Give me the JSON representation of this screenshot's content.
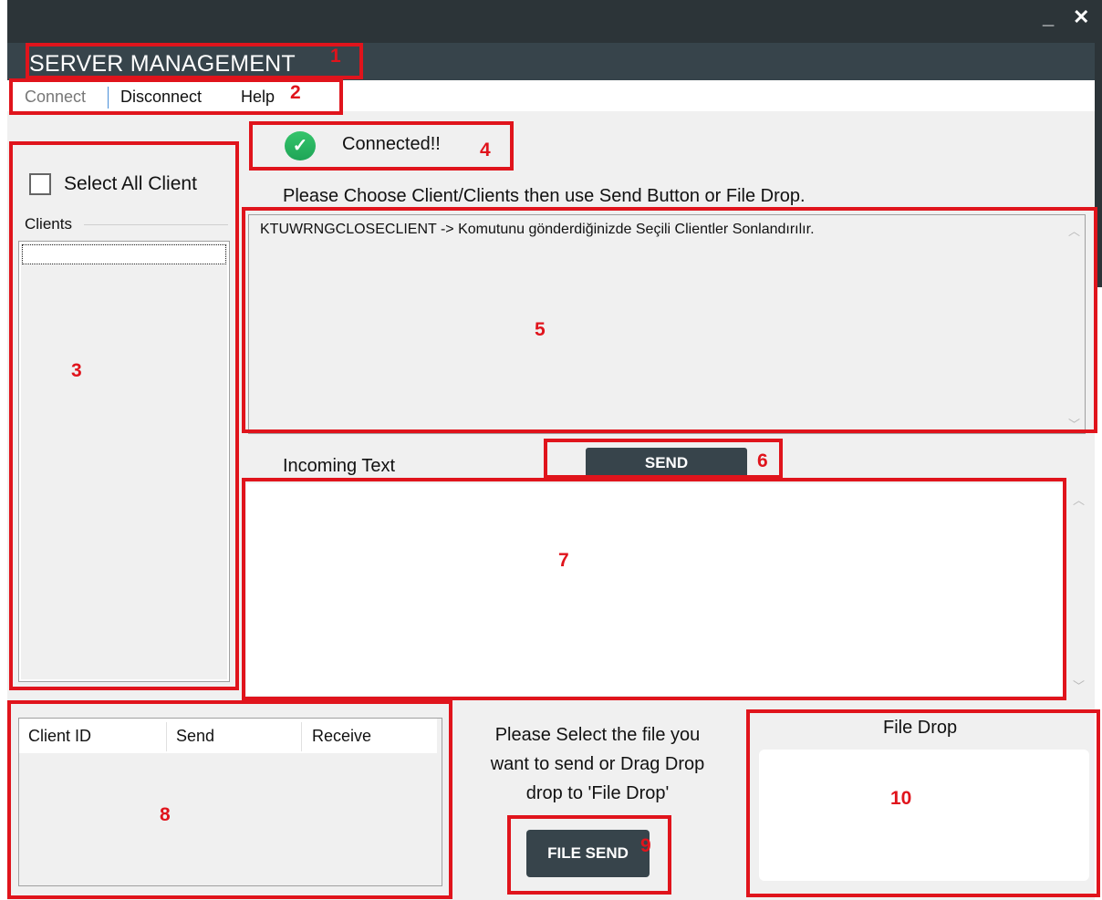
{
  "window": {
    "title": "SERVER MANAGEMENT",
    "minimize_glyph": "_",
    "close_glyph": "✕"
  },
  "menu": {
    "items": [
      {
        "label": "Connect"
      },
      {
        "label": "Disconnect"
      },
      {
        "label": "Help"
      }
    ]
  },
  "status": {
    "text": "Connected!!",
    "icon": "check-circle-icon",
    "color": "#1fa557"
  },
  "clients_panel": {
    "select_all_label": "Select All Client",
    "select_all_checked": false,
    "group_label": "Clients",
    "items": []
  },
  "send_area": {
    "instruction": "Please Choose Client/Clients then use Send Button or File Drop.",
    "text": "KTUWRNGCLOSECLIENT -> Komutunu gönderdiğinizde Seçili Clientler Sonlandırılır."
  },
  "send_button": {
    "label": "SEND"
  },
  "incoming": {
    "label": "Incoming Text",
    "text": ""
  },
  "transfer_table": {
    "columns": [
      "Client ID",
      "Send",
      "Receive"
    ],
    "rows": []
  },
  "file_section": {
    "instruction_lines": [
      "Please Select the file you",
      "want to send or Drag Drop",
      "drop to 'File Drop'"
    ],
    "file_send_label": "FILE SEND",
    "file_drop_label": "File Drop"
  },
  "annotations": [
    "1",
    "2",
    "3",
    "4",
    "5",
    "6",
    "7",
    "8",
    "9",
    "10"
  ],
  "colors": {
    "titlebar": "#2c3438",
    "header": "#37444b",
    "button": "#37444b",
    "annotation_red": "#e0141c"
  }
}
